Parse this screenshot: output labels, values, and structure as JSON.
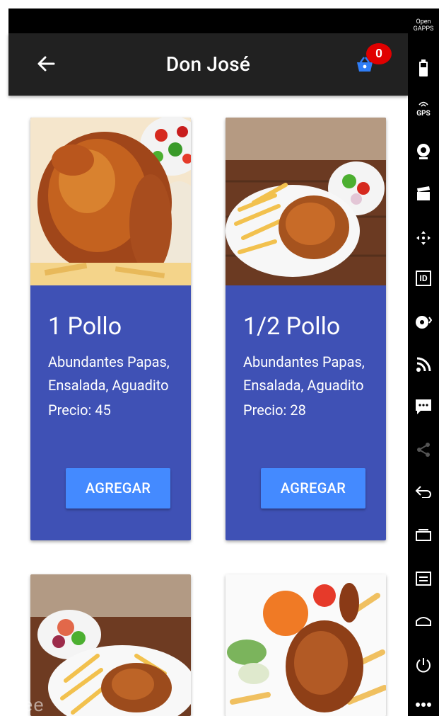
{
  "appbar": {
    "title": "Don José",
    "cart_count": "0"
  },
  "products": [
    {
      "name": "1 Pollo",
      "description": "Abundantes Papas, Ensalada, Aguadito",
      "price_label": "Precio: 45",
      "button_label": "AGREGAR"
    },
    {
      "name": "1/2 Pollo",
      "description": "Abundantes Papas, Ensalada, Aguadito",
      "price_label": "Precio: 28",
      "button_label": "AGREGAR"
    }
  ],
  "navbar": {
    "items": [
      "opengapps-icon",
      "battery-icon",
      "gps-icon",
      "camera-icon",
      "clapperboard-icon",
      "dpad-icon",
      "id-icon",
      "record-icon",
      "rss-icon",
      "message-icon",
      "share-icon",
      "back-icon",
      "recent-apps-icon",
      "menu-icon",
      "home-icon",
      "power-icon",
      "more-icon"
    ],
    "opengapps_text": "Open GAPPS",
    "gps_text": "GPS",
    "id_text": "ID"
  },
  "watermark": "free"
}
